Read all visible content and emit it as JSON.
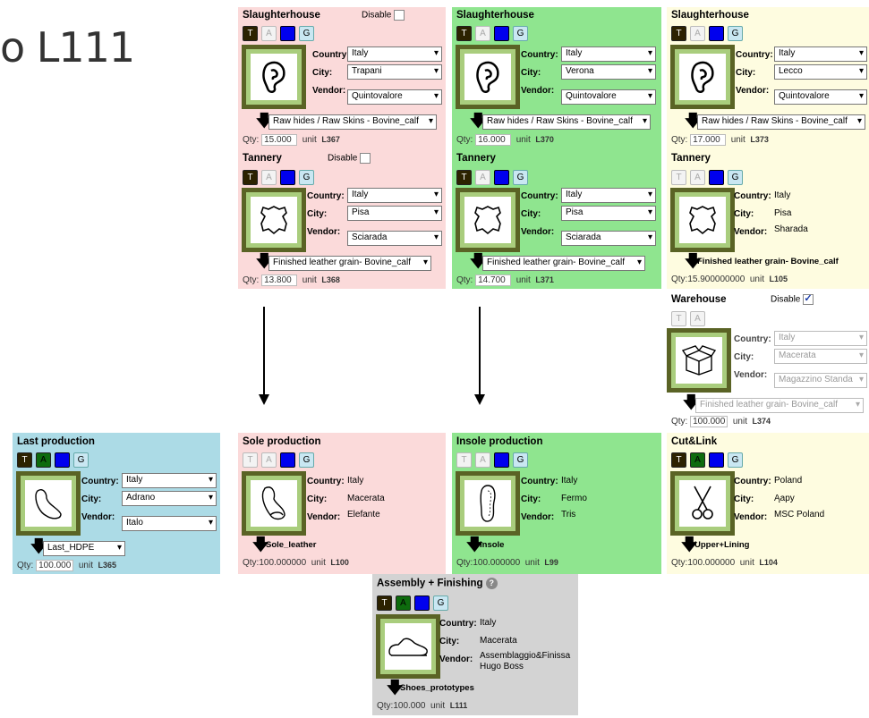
{
  "page_title": "o L111",
  "buttons": {
    "t": "T",
    "a": "A",
    "g": "G"
  },
  "labels": {
    "country": "Country:",
    "city": "City:",
    "vendor": "Vendor:",
    "qty": "Qty:",
    "unit": "unit",
    "disable": "Disable"
  },
  "cards": [
    {
      "title": "Slaughterhouse",
      "disable": true,
      "disabled_checked": false,
      "country": "Italy",
      "city": "Trapani",
      "vendor": "Quintovalore",
      "product": "Raw hides / Raw Skins - Bovine_calf",
      "qty": "15.000",
      "lot": "L367"
    },
    {
      "title": "Tannery",
      "disable": true,
      "disabled_checked": false,
      "country": "Italy",
      "city": "Pisa",
      "vendor": "Sciarada",
      "product": "Finished leather grain- Bovine_calf",
      "qty": "13.800",
      "lot": "L368"
    },
    {
      "title": "Slaughterhouse",
      "country": "Italy",
      "city": "Verona",
      "vendor": "Quintovalore",
      "product": "Raw hides / Raw Skins - Bovine_calf",
      "qty": "16.000",
      "lot": "L370"
    },
    {
      "title": "Tannery",
      "country": "Italy",
      "city": "Pisa",
      "vendor": "Sciarada",
      "product": "Finished leather grain- Bovine_calf",
      "qty": "14.700",
      "lot": "L371"
    },
    {
      "title": "Slaughterhouse",
      "country": "Italy",
      "city": "Lecco",
      "vendor": "Quintovalore",
      "product": "Raw hides / Raw Skins - Bovine_calf",
      "qty": "17.000",
      "lot": "L373"
    },
    {
      "title": "Tannery",
      "country": "Italy",
      "city": "Pisa",
      "vendor": "Sharada",
      "product": "Finished leather grain- Bovine_calf",
      "qty": "Qty:15.900000000",
      "lot": "L105"
    },
    {
      "title": "Warehouse",
      "disable": true,
      "disabled_checked": true,
      "country": "Italy",
      "city": "Macerata",
      "vendor": "Magazzino Standa",
      "product": "Finished leather grain- Bovine_calf",
      "qty": "100.000",
      "lot": "L374"
    },
    {
      "title": "Last production",
      "country": "Italy",
      "city": "Adrano",
      "vendor": "Italo",
      "product": "Last_HDPE",
      "qty": "100.000",
      "lot": "L365"
    },
    {
      "title": "Sole production",
      "country": "Italy",
      "city": "Macerata",
      "vendor": "Elefante",
      "product": "Sole_leather",
      "qty": "Qty:100.000000",
      "lot": "L100"
    },
    {
      "title": "Insole production",
      "country": "Italy",
      "city": "Fermo",
      "vendor": "Tris",
      "product": "Insole",
      "qty": "Qty:100.000000",
      "lot": "L99"
    },
    {
      "title": "Cut&Link",
      "country": "Poland",
      "city": "Ąapy",
      "vendor": "MSC Poland",
      "product": "Upper+Lining",
      "qty": "Qty:100.000000",
      "lot": "L104"
    },
    {
      "title": "Assembly + Finishing",
      "country": "Italy",
      "city": "Macerata",
      "vendor": "Assemblaggio&Finissa Hugo Boss",
      "product": "Shoes_prototypes",
      "qty": "Qty:100.000",
      "lot": "L111"
    }
  ],
  "colors": {
    "pink": "#fbdada",
    "green": "#8fe58f",
    "yellow": "#fefce0",
    "blue": "#acdbe6",
    "gray": "#d3d3d3"
  }
}
